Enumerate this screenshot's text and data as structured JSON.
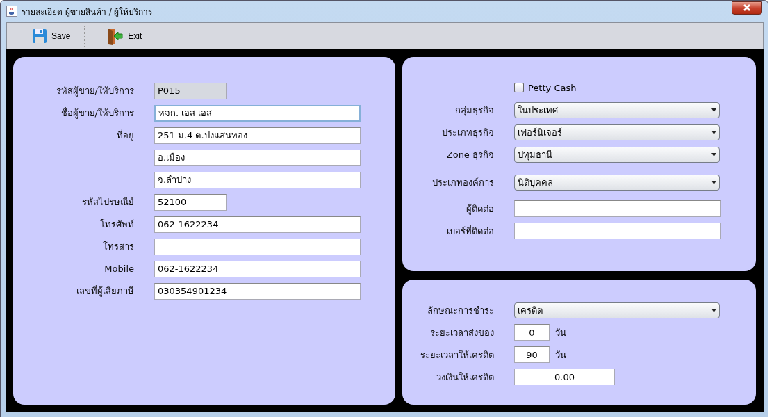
{
  "window": {
    "title": "รายละเอียด ผู้ขายสินค้า / ผู้ให้บริการ"
  },
  "toolbar": [
    {
      "label": "Save",
      "kind": "save"
    },
    {
      "label": "Exit",
      "kind": "exit"
    }
  ],
  "vendor": {
    "fields": [
      {
        "label": "รหัสผู้ขาย/ให้บริการ",
        "value": "P015",
        "kind": "short",
        "disabled": true,
        "focused": false
      },
      {
        "label": "ชื่อผู้ขาย/ให้บริการ",
        "value": "หจก. เอส เอส",
        "kind": "long",
        "disabled": false,
        "focused": true
      },
      {
        "label": "ที่อยู่",
        "value": "251 ม.4 ต.ปงแสนทอง",
        "kind": "long",
        "disabled": false,
        "focused": false
      },
      {
        "value": "อ.เมือง",
        "kind": "long",
        "disabled": false,
        "focused": false
      },
      {
        "value": "จ.ลำปาง",
        "kind": "long",
        "disabled": false,
        "focused": false
      },
      {
        "label": "รหัสไปรษณีย์",
        "value": "52100",
        "kind": "short",
        "disabled": false,
        "focused": false
      },
      {
        "label": "โทรศัพท์",
        "value": "062-1622234",
        "kind": "long",
        "disabled": false,
        "focused": false
      },
      {
        "label": "โทรสาร",
        "kind": "long",
        "disabled": false,
        "focused": false
      },
      {
        "label": "Mobile",
        "value": "062-1622234",
        "kind": "long",
        "disabled": false,
        "focused": false
      },
      {
        "label": "เลขที่ผู้เสียภาษี",
        "value": "030354901234",
        "kind": "long",
        "disabled": false,
        "focused": false
      }
    ]
  },
  "business": {
    "petty_cash": {
      "label": "Petty Cash",
      "checked": false
    },
    "rows": [
      {
        "label": "กลุ่มธุรกิจ",
        "value": "ในประเทศ",
        "kind": "select"
      },
      {
        "label": "ประเภทธุรกิจ",
        "value": "เฟอร์นิเจอร์",
        "kind": "select"
      },
      {
        "label": "Zone ธุรกิจ",
        "value": "ปทุมธานี",
        "kind": "select"
      },
      {
        "label": "ประเภทองค์การ",
        "value": "นิติบุคคล",
        "kind": "select"
      },
      {
        "label": "ผู้ติดต่อ",
        "kind": "text"
      },
      {
        "label": "เบอร์ที่ติดต่อ",
        "kind": "text"
      }
    ]
  },
  "payment": {
    "rows": [
      {
        "label": "ลักษณะการชำระ",
        "value": "เครดิต",
        "kind": "select"
      },
      {
        "label": "ระยะเวลาส่งของ",
        "value": "0",
        "unit": "วัน",
        "kind": "days"
      },
      {
        "label": "ระยะเวลาให้เครดิต",
        "value": "90",
        "unit": "วัน",
        "kind": "days"
      },
      {
        "label": "วงเงินให้เครดิต",
        "value": "0.00",
        "kind": "amount"
      }
    ]
  }
}
